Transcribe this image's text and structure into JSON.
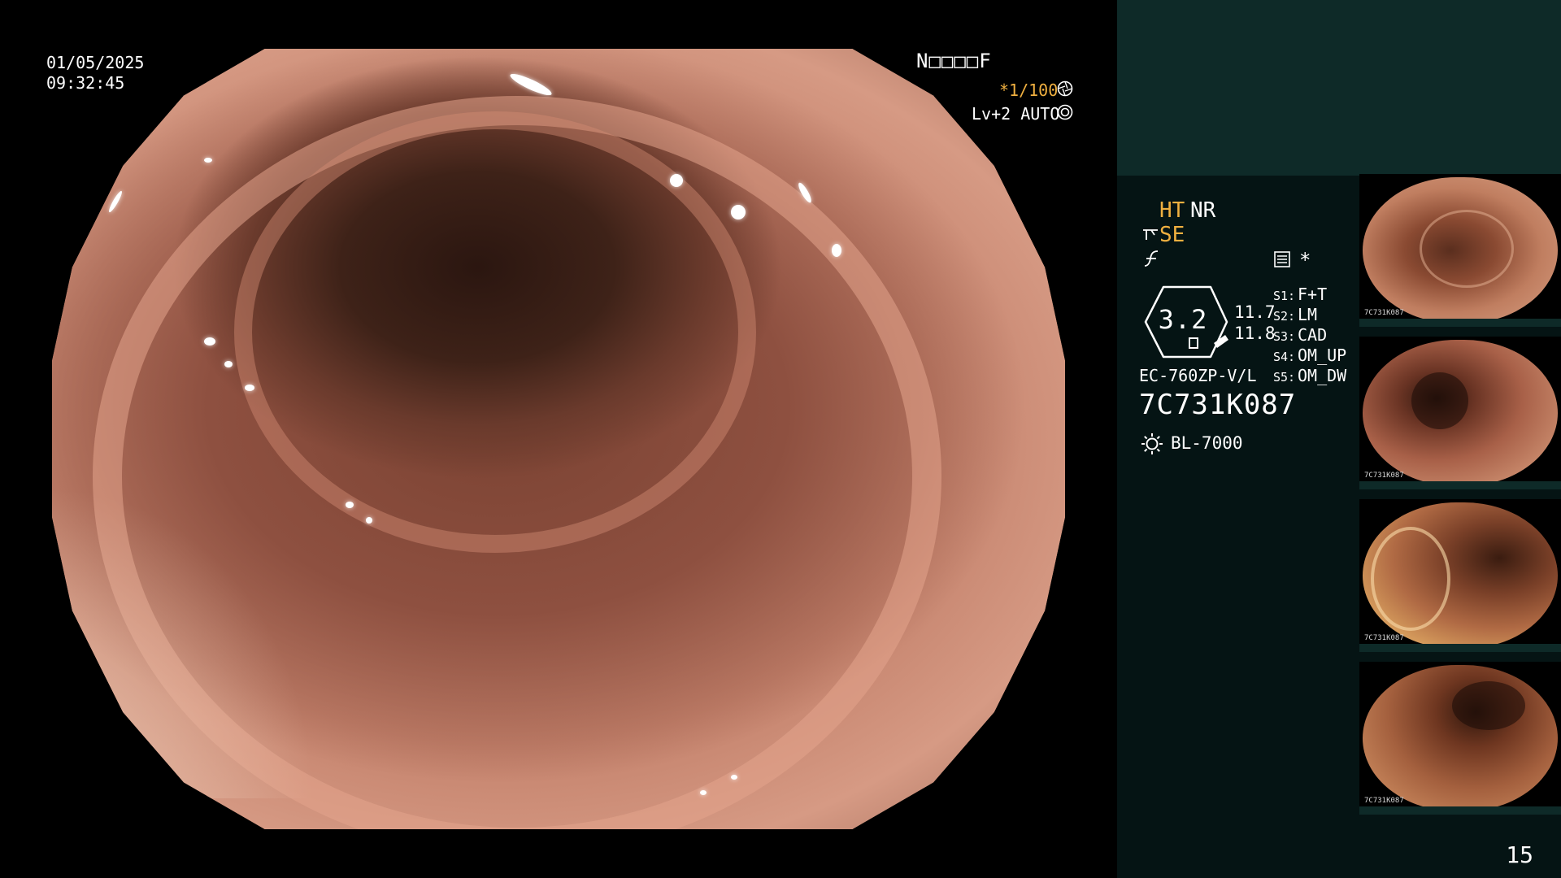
{
  "osd": {
    "date": "01/05/2025",
    "time": "09:32:45",
    "patient_name": "N□□□□F",
    "shutter": "*1/100",
    "level": "Lv+2 AUTO"
  },
  "info": {
    "ht": "HT",
    "nr": "NR",
    "se": "SE",
    "star": "*",
    "scope_value": "3.2",
    "readout_1": "11.7",
    "readout_2": "11.8",
    "settings": [
      {
        "key": "S1:",
        "value": "F+T"
      },
      {
        "key": "S2:",
        "value": "LM"
      },
      {
        "key": "S3:",
        "value": "CAD"
      },
      {
        "key": "S4:",
        "value": "OM_UP"
      },
      {
        "key": "S5:",
        "value": "OM_DW"
      }
    ],
    "scope_model": "EC-760ZP-V/L",
    "scope_serial": "7C731K087",
    "light_source": "BL-7000"
  },
  "thumbnails": [
    {
      "tag": "7C731K087"
    },
    {
      "tag": "7C731K087"
    },
    {
      "tag": "7C731K087"
    },
    {
      "tag": "7C731K087"
    }
  ],
  "page_number": "15",
  "colors": {
    "accent": "#f0b040",
    "panel": "#051414",
    "panel_top": "#0e2a28",
    "text": "#ffffff"
  },
  "icons": {
    "shutter": "shutter-icon",
    "level": "iris-icon",
    "se": "enhance-icon",
    "f": "freeze-icon",
    "memo": "memo-icon",
    "light": "sun-icon"
  }
}
